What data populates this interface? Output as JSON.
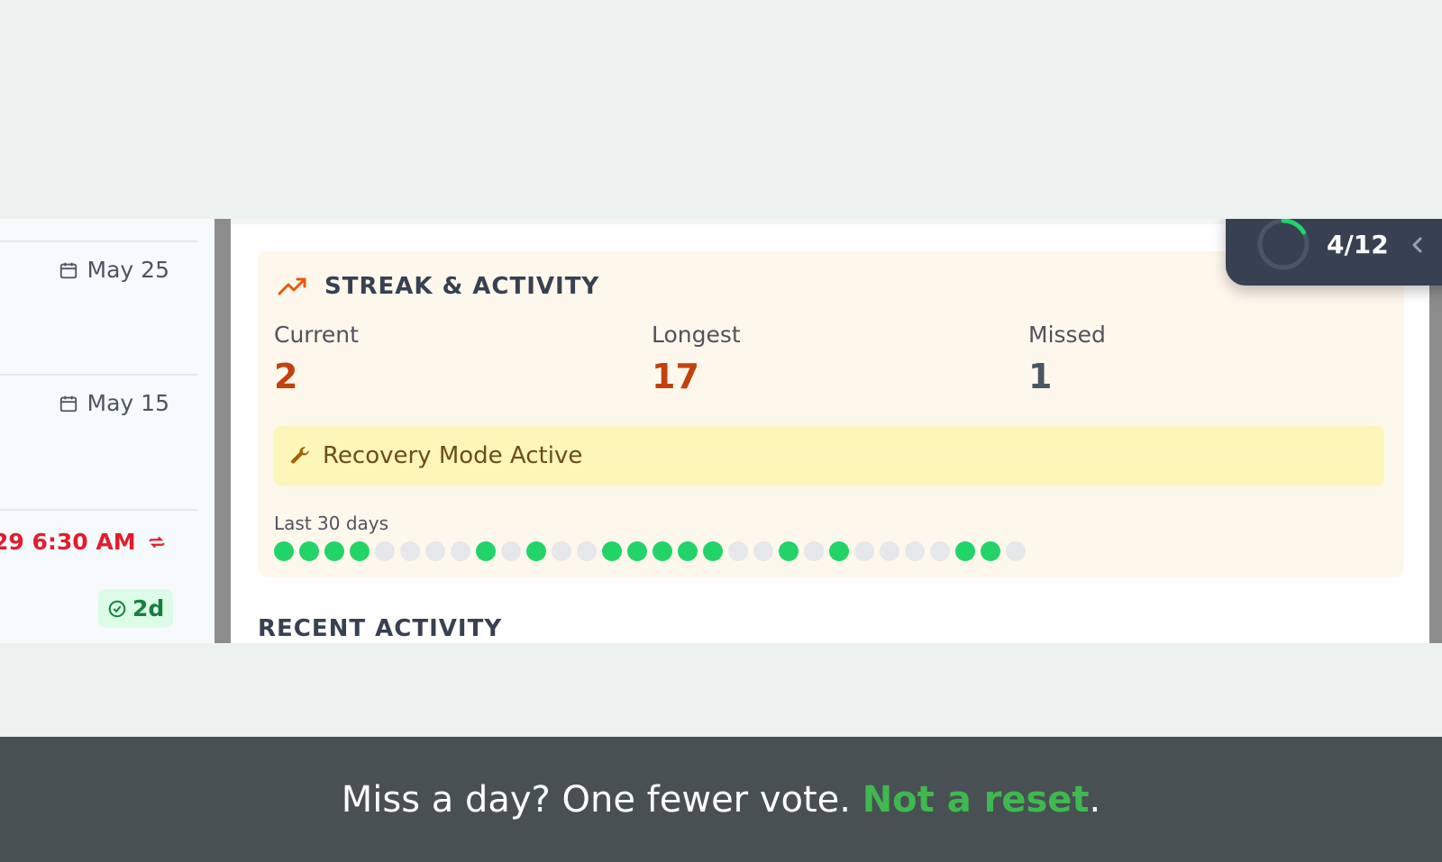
{
  "left_list": {
    "dates": [
      "May 25",
      "May 15"
    ],
    "time_label": "29 6:30 AM",
    "badge": "2d"
  },
  "streak": {
    "title": "STREAK & ACTIVITY",
    "current_label": "Current",
    "current_value": "2",
    "longest_label": "Longest",
    "longest_value": "17",
    "missed_label": "Missed",
    "missed_value": "1",
    "recovery_text": "Recovery Mode Active",
    "last_days_label": "Last 30 days",
    "days": [
      1,
      1,
      1,
      1,
      0,
      0,
      0,
      0,
      1,
      0,
      1,
      0,
      0,
      1,
      1,
      1,
      1,
      1,
      0,
      0,
      1,
      0,
      1,
      0,
      0,
      0,
      0,
      1,
      1,
      0
    ]
  },
  "recent_heading": "RECENT ACTIVITY",
  "progress": {
    "text": "4/12",
    "fraction": 0.333
  },
  "caption": {
    "part1": "Miss a day? One fewer vote. ",
    "highlight": "Not a reset",
    "part2": "."
  },
  "colors": {
    "accent_green": "#22d468",
    "streak_red": "#c2410c",
    "alert_red": "#e11d2e"
  },
  "icons": [
    "calendar-icon",
    "repeat-icon",
    "check-circle-icon",
    "trend-up-icon",
    "wrench-icon",
    "chevron-left-icon"
  ]
}
